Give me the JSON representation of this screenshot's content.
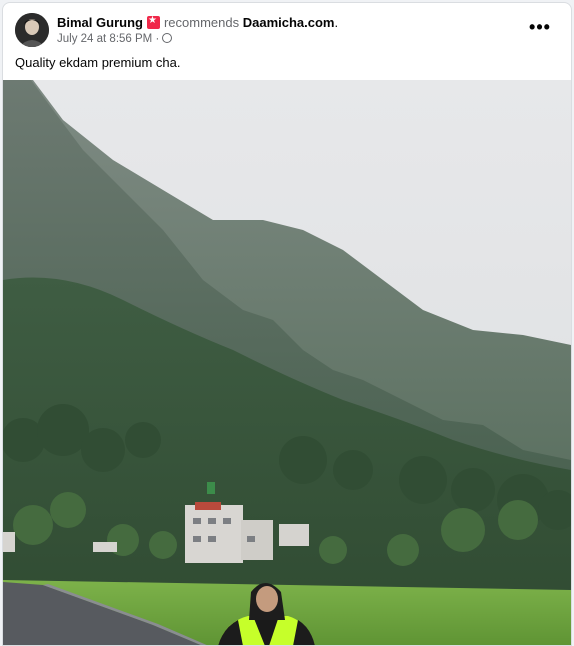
{
  "post": {
    "author": "Bimal Gurung",
    "recommends_text": "recommends",
    "page_name": "Daamicha.com",
    "period": ".",
    "timestamp": "July 24 at 8:56 PM",
    "separator": "·",
    "privacy_icon": "globe-icon",
    "more_options_icon": "more-horizontal-icon",
    "more_options_label": "•••",
    "caption": "Quality ekdam premium cha."
  },
  "photo": {
    "description_icon": "landscape-photo",
    "palette": {
      "sky": "#e3e4e6",
      "mountain_far": "#5b6b60",
      "forest": "#3f5a40",
      "field": "#6fa23a",
      "road": "#5a5d62",
      "jacket": "#c6ff2a"
    }
  }
}
